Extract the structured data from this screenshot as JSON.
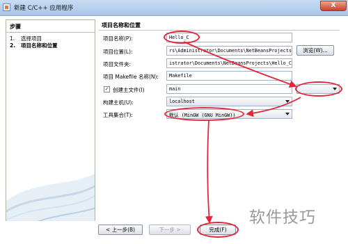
{
  "window": {
    "title": "新建 C/C++ 应用程序",
    "close_label": "X"
  },
  "steps": {
    "header": "步骤",
    "items": [
      {
        "num": "1.",
        "label": "选择项目"
      },
      {
        "num": "2.",
        "label": "项目名称和位置"
      }
    ]
  },
  "form": {
    "section_title": "项目名称和位置",
    "project_name_label": "项目名称(P):",
    "project_name_value": "Hello_C",
    "project_location_label": "项目位置(L):",
    "project_location_value": "rs\\Administrator\\Documents\\NetBeansProjects",
    "browse_label": "浏览(W)...",
    "project_folder_label": "项目文件夹:",
    "project_folder_value": "istrator\\Documents\\NetBeansProjects\\Hello_C",
    "makefile_label": "项目 Makefile 名称(N):",
    "makefile_value": "Makefile",
    "create_main_label": "创建主文件(I)",
    "create_main_checked": "✓",
    "main_value": "main",
    "build_host_label": "构建主机(U):",
    "build_host_value": "localhost",
    "tool_collection_label": "工具集合(T):",
    "tool_collection_value": "默认 (MinGW (GNU MinGW))"
  },
  "buttons": {
    "back": "< 上一步(B)",
    "next": "下一步 >",
    "finish": "完成(F)"
  },
  "watermark": "软件技巧",
  "colors": {
    "annotation": "#e3263b",
    "panel_border": "#a9b8a0"
  }
}
